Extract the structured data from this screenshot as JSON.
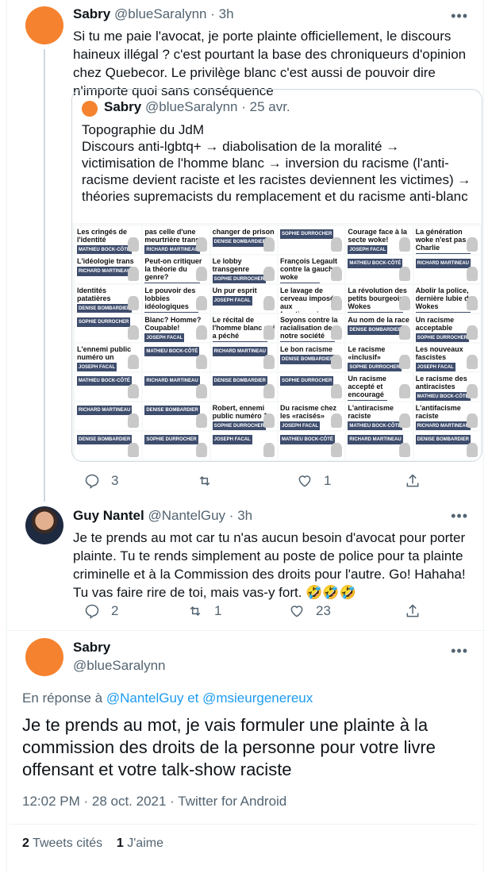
{
  "tweet1": {
    "name": "Sabry",
    "handle": "@blueSaralynn",
    "separator": "·",
    "time": "3h",
    "text": "Si tu me paie l'avocat, je porte plainte officiellement, le discours haineux illégal ? c'est pourtant la base des chroniqueurs d'opinion chez Quebecor. Le privilège blanc c'est aussi de pouvoir dire n'importe quoi sans conséquence",
    "quote": {
      "name": "Sabry",
      "handle": "@blueSaralynn",
      "separator": "·",
      "time": "25 avr.",
      "text": "Topographie du JdM\nDiscours anti-lgbtq+ → diabolisation de la moralité → victimisation de l'homme blanc → inversion du racisme (l'anti-racisme devient raciste et les racistes deviennent les victimes) → théories supremacists du remplacement et du racisme anti-blanc"
    },
    "actions": {
      "replies": "3",
      "retweets": "",
      "likes": "1"
    }
  },
  "tweet2": {
    "name": "Guy Nantel",
    "handle": "@NantelGuy",
    "separator": "·",
    "time": "3h",
    "text": "Je te prends au mot car tu n'as aucun besoin d'avocat pour porter plainte. Tu te rends simplement au poste de police pour ta plainte criminelle et à la Commission des droits pour l'autre. Go! Hahaha! Tu vas faire rire de toi, mais vas-y fort. 🤣🤣🤣",
    "actions": {
      "replies": "2",
      "retweets": "1",
      "likes": "23"
    }
  },
  "main_tweet": {
    "name": "Sabry",
    "handle": "@blueSaralynn",
    "reply_prefix": "En réponse à",
    "reply_user1": "@NantelGuy",
    "reply_joiner": "et",
    "reply_user2": "@msieurgenereux",
    "text": "Je te prends au mot, je vais formuler une plainte à la commission des droits de la personne pour votre livre offensant et votre talk-show raciste",
    "timestamp": "12:02 PM · 28 oct. 2021 · Twitter for Android",
    "quote_count": "2",
    "quote_label": "Tweets cités",
    "like_count": "1",
    "like_label": "J'aime"
  },
  "collage_cells": [
    "Les cringés de l'identité",
    "pas celle d'une meurtrière trans",
    "changer de prison",
    "",
    "Courage face à la secte woke!",
    "La génération woke n'est pas Charlie",
    "L'idéologie trans",
    "Peut-on critiquer la théorie du genre?",
    "Le lobby transgenre",
    "François Legault contre la gauche woke",
    "",
    "",
    "Identités patatières",
    "Le pouvoir des lobbies idéologiques",
    "Un pur esprit",
    "Le lavage de cerveau imposé aux fonctionnaires fédéraux",
    "La révolution des petits bourgeois Wokes",
    "Abolir la police, dernière lubie des Wokes",
    "",
    "Blanc? Homme? Coupable!",
    "Le récital de l'homme blanc qui a péché",
    "Soyons contre la racialisation de notre société",
    "Au nom de la race",
    "Un racisme acceptable",
    "L'ennemi public numéro un",
    "",
    "",
    "Le bon racisme",
    "Le racisme «inclusif»",
    "Les nouveaux fascistes",
    "",
    "",
    "",
    "",
    "Un racisme accepté et encouragé",
    "Le racisme des antiracistes",
    "",
    "",
    "Robert, ennemi public numéro 1",
    "Du racisme chez les «racisés»",
    "L'antiracisme raciste",
    "L'antifacisme raciste",
    "",
    "",
    "",
    "",
    "",
    ""
  ],
  "collage_tags": [
    "MATHIEU BOCK-CÔTÉ",
    "RICHARD MARTINEAU",
    "DENISE BOMBARDIER",
    "SOPHIE DURROCHER",
    "JOSEPH FACAL"
  ],
  "colors": {
    "accent": "#1d9bf0",
    "avatar_orange": "#f5822e",
    "text": "#0f1419",
    "muted": "#536471",
    "border": "#cfd9de"
  }
}
